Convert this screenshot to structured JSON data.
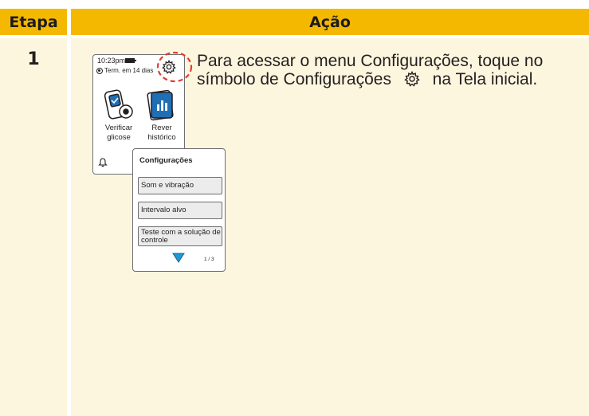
{
  "header": {
    "step_label": "Etapa",
    "action_label": "Ação"
  },
  "step": {
    "number": "1",
    "instruction_part1": "Para acessar o menu Configurações, toque no símbolo de Configurações",
    "instruction_part2": "na Tela inicial."
  },
  "home_screen": {
    "time": "10:23pm",
    "sensor_status": "Term. em 14 dias",
    "tile1_line1": "Verificar",
    "tile1_line2": "glicose",
    "tile2_line1": "Rever",
    "tile2_line2": "histórico"
  },
  "settings_menu": {
    "title": "Configurações",
    "items": [
      "Som e vibração",
      "Intervalo alvo",
      "Teste com a solução de controle"
    ],
    "page_indicator": "1 / 3"
  },
  "colors": {
    "header": "#f5b800",
    "column_bg": "#fdf6df",
    "accent_red": "#e03c31",
    "device_blue": "#1f6fb5"
  }
}
